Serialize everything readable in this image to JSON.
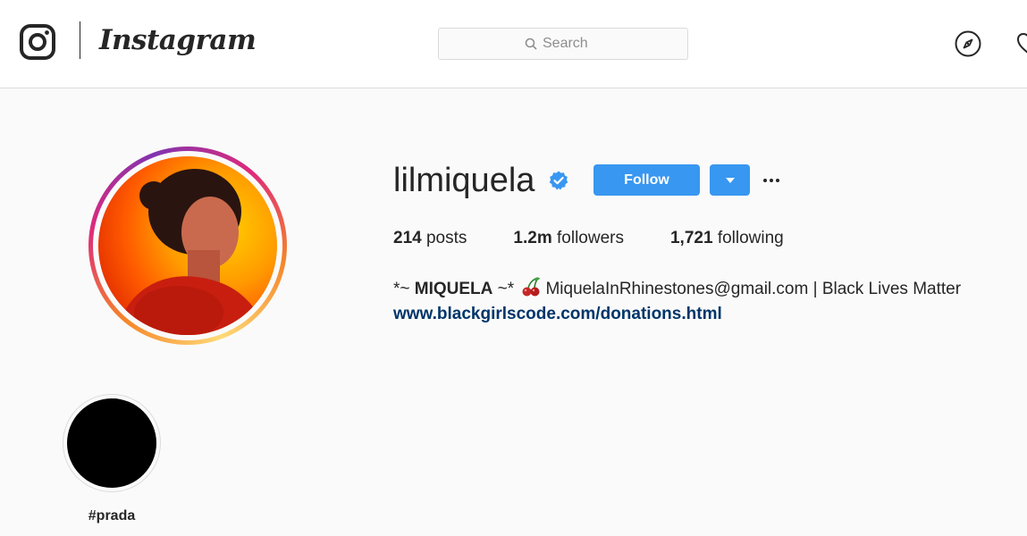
{
  "header": {
    "brand_wordmark": "Instagram",
    "search": {
      "placeholder": "Search"
    },
    "icons": [
      "instagram-glyph-icon",
      "search-icon",
      "explore-compass-icon",
      "heart-icon"
    ]
  },
  "profile": {
    "username": "lilmiquela",
    "verified": true,
    "follow_label": "Follow",
    "stats": {
      "posts_count": "214",
      "posts_label": "posts",
      "followers_count": "1.2m",
      "followers_label": "followers",
      "following_count": "1,721",
      "following_label": "following"
    },
    "bio": {
      "prefix": "*~ ",
      "name": "MIQUELA",
      "suffix": " ~*",
      "emoji_icon": "cherry-icon",
      "rest": "MiquelaInRhinestones@gmail.com | Black Lives Matter",
      "link": "www.blackgirlscode.com/donations.html"
    }
  },
  "highlights": [
    {
      "label": "#prada"
    }
  ],
  "colors": {
    "accent": "#3897f0",
    "link": "#003569",
    "verified": "#3897f0",
    "background": "#fafafa"
  }
}
